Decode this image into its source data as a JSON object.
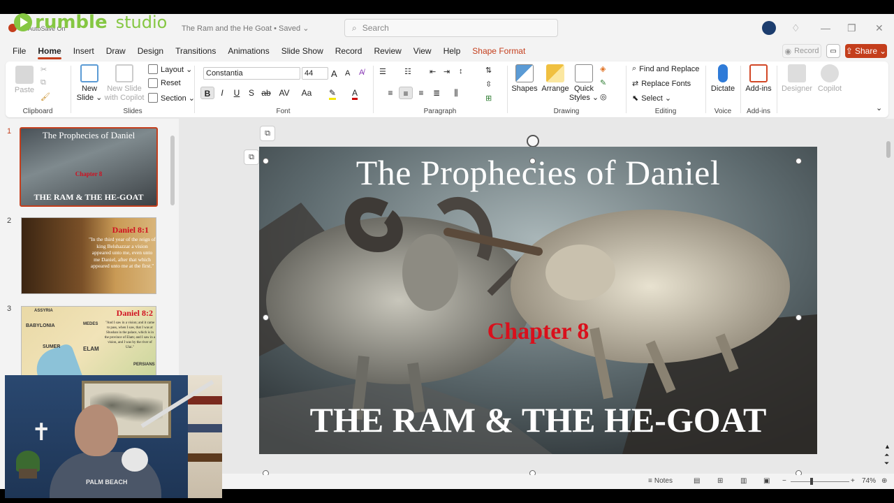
{
  "watermark": {
    "brand": "rumble",
    "sub": "studio"
  },
  "titlebar": {
    "autosave": "AutoSave",
    "autosave_state": "On",
    "doc_title": "The Ram and the He Goat • Saved ⌄",
    "search_placeholder": "Search"
  },
  "tabs": [
    "File",
    "Home",
    "Insert",
    "Draw",
    "Design",
    "Transitions",
    "Animations",
    "Slide Show",
    "Record",
    "Review",
    "View",
    "Help",
    "Shape Format"
  ],
  "tabs_active": "Home",
  "header_buttons": {
    "record": "Record",
    "share": "Share"
  },
  "ribbon": {
    "clipboard": {
      "label": "Clipboard",
      "paste": "Paste"
    },
    "slides": {
      "label": "Slides",
      "new_slide": "New\nSlide ⌄",
      "new_slide_copilot": "New Slide\nwith Copilot",
      "layout": "Layout ⌄",
      "reset": "Reset",
      "section": "Section ⌄"
    },
    "font": {
      "label": "Font",
      "font_name": "Constantia",
      "font_size": "44"
    },
    "paragraph": {
      "label": "Paragraph"
    },
    "drawing": {
      "label": "Drawing",
      "shapes": "Shapes",
      "arrange": "Arrange",
      "quick_styles": "Quick\nStyles ⌄"
    },
    "editing": {
      "label": "Editing",
      "find_replace": "Find and Replace",
      "replace_fonts": "Replace Fonts",
      "select": "Select ⌄"
    },
    "voice": {
      "label": "Voice",
      "dictate": "Dictate"
    },
    "addins": {
      "label": "Add-ins",
      "addins": "Add-ins"
    },
    "designer": "Designer",
    "copilot": "Copilot"
  },
  "thumbnails": [
    {
      "num": "1",
      "title": "The Prophecies of Daniel",
      "chapter": "Chapter 8",
      "subtitle": "THE RAM & THE HE-GOAT"
    },
    {
      "num": "2",
      "heading": "Daniel 8:1",
      "quote": "\"In the third year of the reign of king Belshazzar a vision appeared unto me, even unto me Daniel, after that which appeared unto me at the first.\""
    },
    {
      "num": "3",
      "heading": "Daniel 8:2",
      "labels": [
        "ASSYRIA",
        "BABYLONIA",
        "MEDES",
        "SUMER",
        "ELAM",
        "PERSIANS"
      ],
      "quote": "\"And I saw in a vision; and it came to pass, when I saw, that I was at Shushan in the palace, which is in the province of Elam; and I saw in a vision, and I was by the river of Ulai.\""
    }
  ],
  "slide": {
    "title": "The Prophecies of Daniel",
    "chapter": "Chapter 8",
    "subtitle": "THE RAM & THE HE-GOAT"
  },
  "statusbar": {
    "notes": "Notes",
    "zoom": "74%"
  },
  "webcam": {
    "hoodie_text": "PALM BEACH"
  },
  "colors": {
    "accent": "#c43e1c",
    "chapter_red": "#d9101c",
    "rumble_green": "#85c742"
  }
}
